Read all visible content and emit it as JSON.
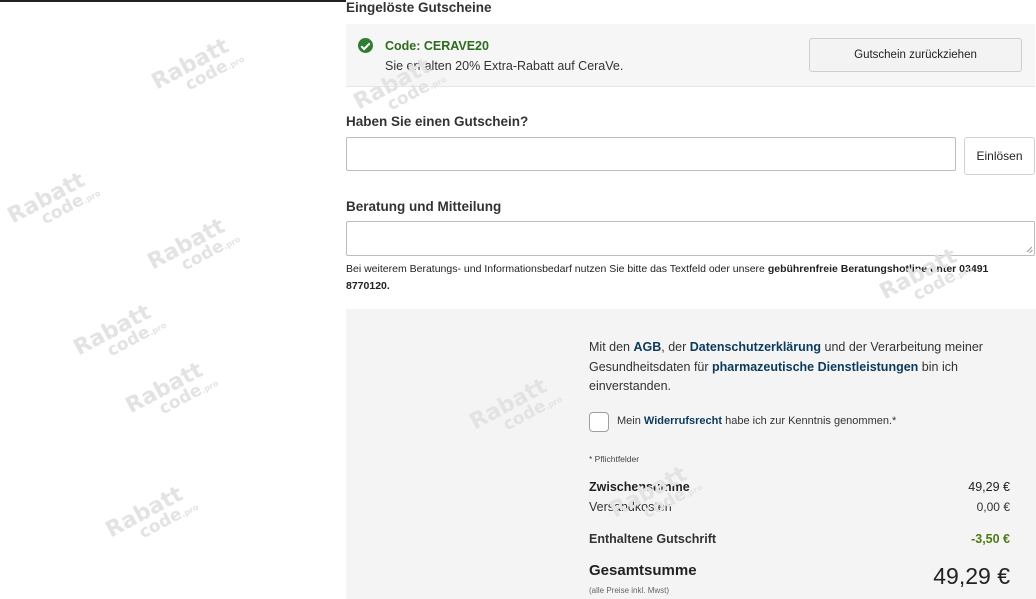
{
  "vouchers": {
    "section_title": "Eingelöste Gutscheine",
    "items": [
      {
        "code": "Code: CERAVE20",
        "description": "Sie erhalten 20% Extra-Rabatt auf CeraVe.",
        "withdraw_label": "Gutschein zurückziehen"
      }
    ]
  },
  "coupon": {
    "title": "Haben Sie einen Gutschein?",
    "input_value": "",
    "redeem_label": "Einlösen"
  },
  "consultation": {
    "title": "Beratung und Mitteilung",
    "textarea_value": "",
    "hint_before": "Bei weiterem Beratungs- und Informationsbedarf nutzen Sie bitte das Textfeld oder unsere ",
    "hint_bold": "gebührenfreie Beratungshotline",
    "hint_after": " unter 03491 8770120."
  },
  "summary": {
    "consent": {
      "t1": "Mit den ",
      "agb": "AGB",
      "t2": ", der ",
      "privacy": "Datenschutzerklärung",
      "t3": " und der Verarbeitung meiner Gesundheitsdaten für ",
      "pharma": "pharmazeutische Dienstleistungen",
      "t4": " bin ich einverstanden."
    },
    "withdrawal": {
      "t1": "Mein ",
      "link": "Widerrufsrecht",
      "t2": " habe ich zur Kenntnis genommen.*",
      "checked": false
    },
    "required_note": "* Pflichtfelder",
    "subtotal_label": "Zwischensumme",
    "subtotal_value": "49,29 €",
    "shipping_label": "Versandkosten",
    "shipping_value": "0,00 €",
    "credit_label": "Enthaltene Gutschrift",
    "credit_value": "-3,50 €",
    "total_label": "Gesamtsumme",
    "total_value": "49,29 €",
    "tax_note": "(alle Preise inkl. Mwst)"
  },
  "watermark": {
    "line1": "Rabatt",
    "line2": "code",
    "suffix": ".pro"
  },
  "colors": {
    "success": "#2e7d32",
    "link": "#0b3a5d",
    "credit": "#4e7a14",
    "panel": "#f4f4f4"
  }
}
